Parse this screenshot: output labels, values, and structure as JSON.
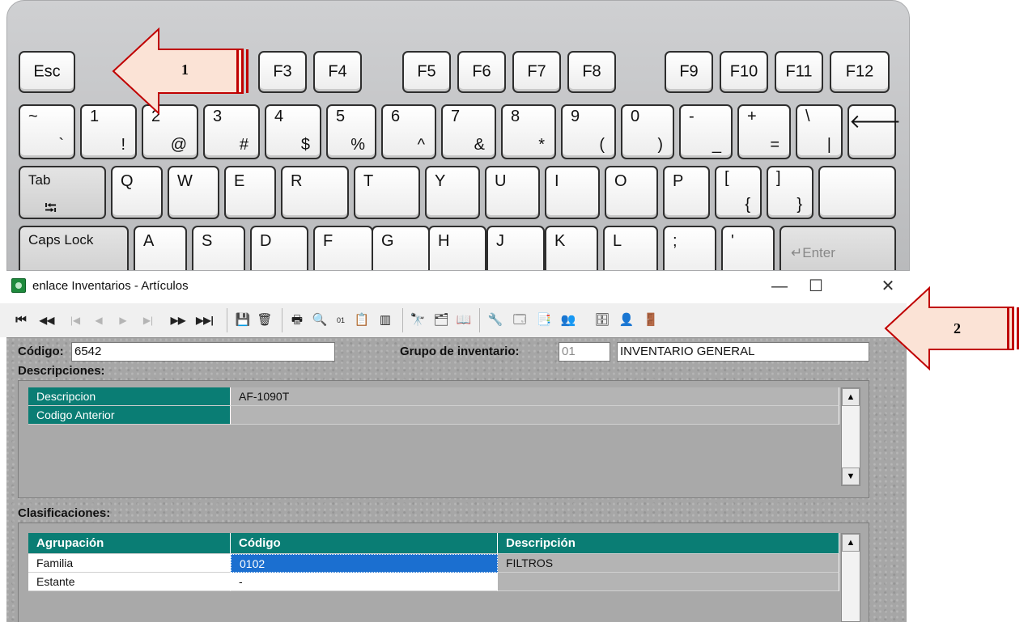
{
  "keyboard": {
    "row_function": [
      {
        "name": "key-esc",
        "label": "Esc"
      },
      {
        "name": "key-f3",
        "label": "F3"
      },
      {
        "name": "key-f4",
        "label": "F4"
      },
      {
        "name": "key-f5",
        "label": "F5"
      },
      {
        "name": "key-f6",
        "label": "F6"
      },
      {
        "name": "key-f7",
        "label": "F7"
      },
      {
        "name": "key-f8",
        "label": "F8"
      },
      {
        "name": "key-f9",
        "label": "F9"
      },
      {
        "name": "key-f10",
        "label": "F10"
      },
      {
        "name": "key-f11",
        "label": "F11"
      },
      {
        "name": "key-f12",
        "label": "F12"
      }
    ],
    "row_numbers": [
      {
        "main": "~",
        "sub": "`"
      },
      {
        "main": "1",
        "sub": "!"
      },
      {
        "main": "2",
        "sub": "@"
      },
      {
        "main": "3",
        "sub": "#"
      },
      {
        "main": "4",
        "sub": "$"
      },
      {
        "main": "5",
        "sub": "%"
      },
      {
        "main": "6",
        "sub": "^"
      },
      {
        "main": "7",
        "sub": "&"
      },
      {
        "main": "8",
        "sub": "*"
      },
      {
        "main": "9",
        "sub": "("
      },
      {
        "main": "0",
        "sub": ")"
      },
      {
        "main": "-",
        "sub": "_"
      },
      {
        "main": "+",
        "sub": "="
      },
      {
        "main": "\\",
        "sub": "|"
      }
    ],
    "backspace_glyph": "🡐",
    "tab_label": "Tab",
    "tab_glyph": "⭾",
    "row_qwerty": [
      "Q",
      "W",
      "E",
      "R",
      "T",
      "Y",
      "U",
      "I",
      "O",
      "P"
    ],
    "bracket_open": {
      "main": "[",
      "sub": "{"
    },
    "bracket_close": {
      "main": "]",
      "sub": "}"
    },
    "caps_label": "Caps Lock",
    "row_asdf": [
      "A",
      "S",
      "D",
      "F",
      "G",
      "H",
      "J",
      "K",
      "L"
    ],
    "semicolon": ";",
    "quote": "'",
    "enter_label": "↵Enter"
  },
  "callouts": {
    "one": "1",
    "two": "2"
  },
  "window": {
    "title": "enlace Inventarios - Artículos",
    "minimize": "—",
    "maximize": "☐",
    "close": "✕"
  },
  "toolbar": {
    "first": "⏮",
    "prev_page": "◀◀",
    "prev_first_dis": "|◀",
    "prev_dis": "◀",
    "next_dis": "▶",
    "last_dis": "▶|",
    "next_page": "▶▶",
    "last": "▶▶|",
    "save": "💾",
    "cancel": "🗑",
    "print": "🖶",
    "preview": "🔍",
    "code": "01",
    "report": "📋",
    "barcode": "▥",
    "find": "🔭",
    "filter": "🗂",
    "book": "📖",
    "tool1": "🔧",
    "tool2": "🗔",
    "tool3": "📑",
    "tool4": "👥",
    "tool5": "🗄",
    "tool6": "👤",
    "exit": "🚪"
  },
  "form": {
    "codigo_label": "Código:",
    "codigo_value": "6542",
    "grupo_label": "Grupo de inventario:",
    "grupo_code": "01",
    "grupo_name": "INVENTARIO GENERAL",
    "descripciones_label": "Descripciones:",
    "descripciones": [
      {
        "field": "Descripcion",
        "value": "AF-1090T"
      },
      {
        "field": "Codigo Anterior",
        "value": ""
      }
    ],
    "clasificaciones_label": "Clasificaciones:",
    "clasif_headers": [
      "Agrupación",
      "Código",
      "Descripción"
    ],
    "clasificaciones": [
      {
        "agrupacion": "Familia",
        "codigo": "0102",
        "descripcion": "FILTROS"
      },
      {
        "agrupacion": "Estante",
        "codigo": "-",
        "descripcion": ""
      }
    ]
  }
}
